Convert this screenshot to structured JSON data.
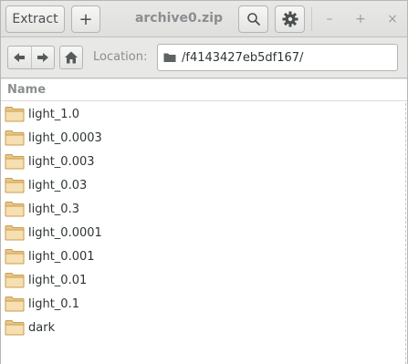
{
  "header": {
    "extract_label": "Extract",
    "add_label": "+",
    "title": "archive0.zip",
    "search_icon": "search-icon",
    "menu_icon": "gear-icon",
    "minimize_label": "–",
    "maximize_label": "+",
    "close_label": "×"
  },
  "toolbar": {
    "back_icon": "arrow-left-icon",
    "forward_icon": "arrow-right-icon",
    "home_icon": "home-icon",
    "location_label": "Location:",
    "location_value": "/f4143427eb5df167/"
  },
  "list": {
    "column_name": "Name",
    "items": [
      {
        "name": "light_1.0"
      },
      {
        "name": "light_0.0003"
      },
      {
        "name": "light_0.003"
      },
      {
        "name": "light_0.03"
      },
      {
        "name": "light_0.3"
      },
      {
        "name": "light_0.0001"
      },
      {
        "name": "light_0.001"
      },
      {
        "name": "light_0.01"
      },
      {
        "name": "light_0.1"
      },
      {
        "name": "dark"
      }
    ]
  },
  "colors": {
    "folder_fill": "#f3d9a4",
    "folder_stroke": "#c99e52",
    "text": "#2e3436",
    "muted": "#8a8e8f"
  }
}
